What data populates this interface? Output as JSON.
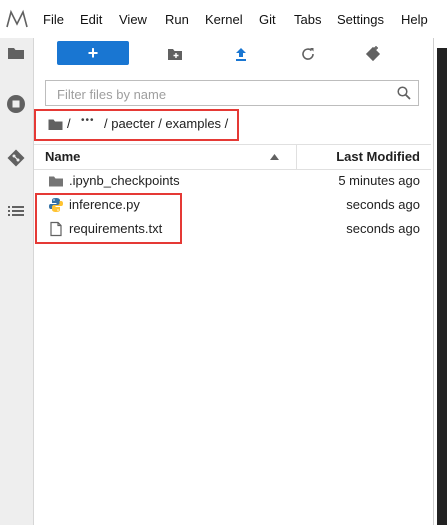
{
  "menu": [
    "File",
    "Edit",
    "View",
    "Run",
    "Kernel",
    "Git",
    "Tabs",
    "Settings",
    "Help"
  ],
  "toolbar": {
    "new_label": "+"
  },
  "filter": {
    "placeholder": "Filter files by name"
  },
  "breadcrumb": {
    "separator_root": "/",
    "ellipsis": "•••",
    "path": "/ paecter / examples /"
  },
  "header": {
    "name": "Name",
    "last_modified": "Last Modified"
  },
  "files": [
    {
      "name": ".ipynb_checkpoints",
      "modified": "5 minutes ago",
      "type": "folder"
    },
    {
      "name": "inference.py",
      "modified": "seconds ago",
      "type": "python"
    },
    {
      "name": "requirements.txt",
      "modified": "seconds ago",
      "type": "text"
    }
  ],
  "colors": {
    "accent": "#1976d2",
    "highlight": "#e53935",
    "sidebar": "#eeeeee"
  }
}
